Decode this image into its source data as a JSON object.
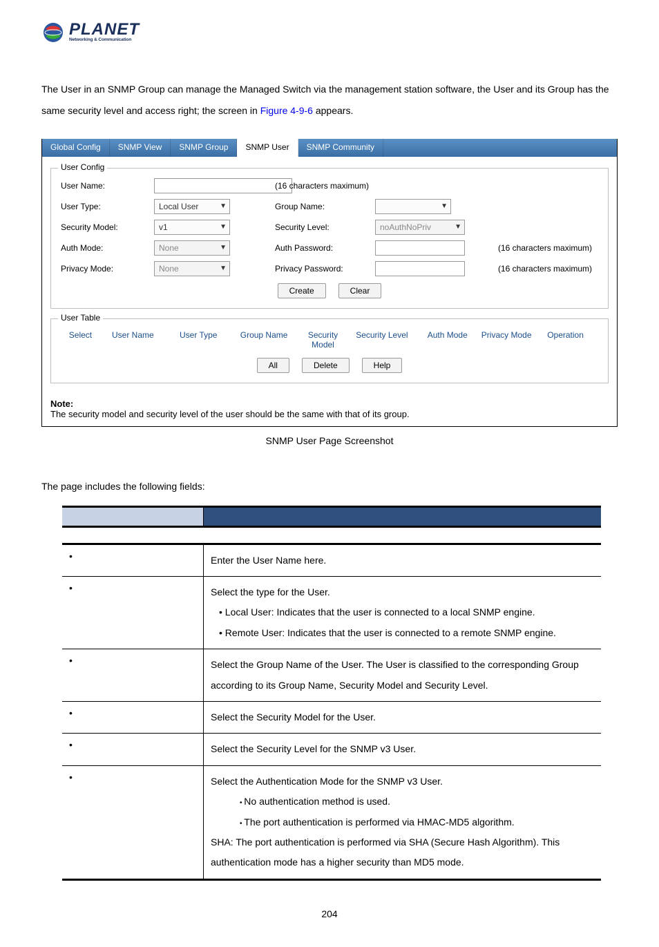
{
  "logo": {
    "main": "PLANET",
    "sub": "Networking & Communication"
  },
  "intro_a": "The User in an SNMP Group can manage the Managed Switch via the management station software, the User and its Group has the same security level and access right; the screen in ",
  "intro_link": "Figure 4-9-6",
  "intro_b": " appears.",
  "tabs": [
    "Global Config",
    "SNMP View",
    "SNMP Group",
    "SNMP User",
    "SNMP Community"
  ],
  "tabs_active_index": 3,
  "user_config": {
    "legend": "User Config",
    "rows": {
      "user_name_lbl": "User Name:",
      "user_name_hint": "(16 characters maximum)",
      "user_type_lbl": "User Type:",
      "user_type_val": "Local User",
      "group_name_lbl": "Group Name:",
      "security_model_lbl": "Security Model:",
      "security_model_val": "v1",
      "security_level_lbl": "Security Level:",
      "security_level_val": "noAuthNoPriv",
      "auth_mode_lbl": "Auth Mode:",
      "auth_mode_val": "None",
      "auth_password_lbl": "Auth Password:",
      "auth_password_hint": "(16 characters maximum)",
      "privacy_mode_lbl": "Privacy Mode:",
      "privacy_mode_val": "None",
      "privacy_password_lbl": "Privacy Password:",
      "privacy_password_hint": "(16 characters maximum)"
    },
    "buttons": {
      "create": "Create",
      "clear": "Clear"
    }
  },
  "user_table": {
    "legend": "User Table",
    "headers": [
      "Select",
      "User Name",
      "User Type",
      "Group Name",
      "Security Model",
      "Security Level",
      "Auth Mode",
      "Privacy Mode",
      "Operation"
    ],
    "buttons": {
      "all": "All",
      "delete": "Delete",
      "help": "Help"
    }
  },
  "note": {
    "title": "Note:",
    "text": "The security model and security level of the user should be the same with that of its group."
  },
  "caption": "SNMP User Page Screenshot",
  "fields_intro": "The page includes the following fields:",
  "desc": [
    {
      "v": "Enter the User Name here."
    },
    {
      "v": "Select the type for the User.",
      "subs": [
        "Local User: Indicates that the user is connected to a local SNMP engine.",
        "Remote User: Indicates that the user is connected to a remote SNMP engine."
      ]
    },
    {
      "v": "Select the Group Name of the User. The User is classified to the corresponding Group according to its Group Name, Security Model and Security Level."
    },
    {
      "v": "Select the Security Model for the User."
    },
    {
      "v": "Select the Security Level for the SNMP v3 User."
    },
    {
      "v": "Select the Authentication Mode for the SNMP v3 User.",
      "subs2": [
        "No authentication method is used.",
        "The port authentication is performed via HMAC-MD5 algorithm."
      ],
      "tail": "SHA: The port authentication is performed via SHA (Secure Hash Algorithm). This authentication mode has a higher security than MD5 mode."
    }
  ],
  "page_number": "204"
}
